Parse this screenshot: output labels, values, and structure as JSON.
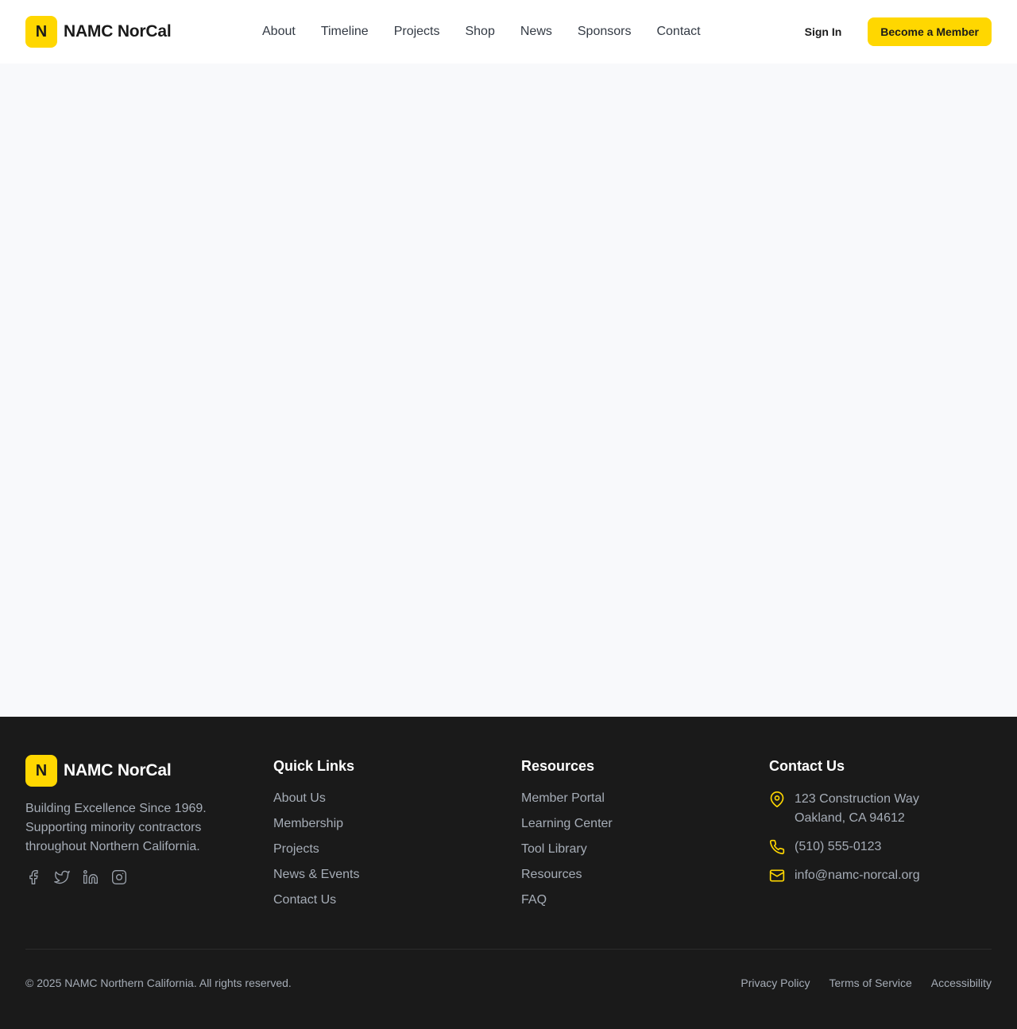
{
  "brand": {
    "mark": "N",
    "name": "NAMC NorCal",
    "accent_color": "#ffd700"
  },
  "header": {
    "nav": [
      "About",
      "Timeline",
      "Projects",
      "Shop",
      "News",
      "Sponsors",
      "Contact"
    ],
    "sign_in": "Sign In",
    "cta": "Become a Member"
  },
  "footer": {
    "tagline": "Building Excellence Since 1969. Supporting minority contractors throughout Northern California.",
    "socials": [
      "facebook-icon",
      "twitter-icon",
      "linkedin-icon",
      "instagram-icon"
    ],
    "quick_links": {
      "title": "Quick Links",
      "items": [
        "About Us",
        "Membership",
        "Projects",
        "News & Events",
        "Contact Us"
      ]
    },
    "resources": {
      "title": "Resources",
      "items": [
        "Member Portal",
        "Learning Center",
        "Tool Library",
        "Resources",
        "FAQ"
      ]
    },
    "contact": {
      "title": "Contact Us",
      "address_line1": "123 Construction Way",
      "address_line2": "Oakland, CA 94612",
      "phone": "(510) 555-0123",
      "email": "info@namc-norcal.org"
    },
    "copyright": "© 2025 NAMC Northern California. All rights reserved.",
    "legal": [
      "Privacy Policy",
      "Terms of Service",
      "Accessibility"
    ]
  }
}
